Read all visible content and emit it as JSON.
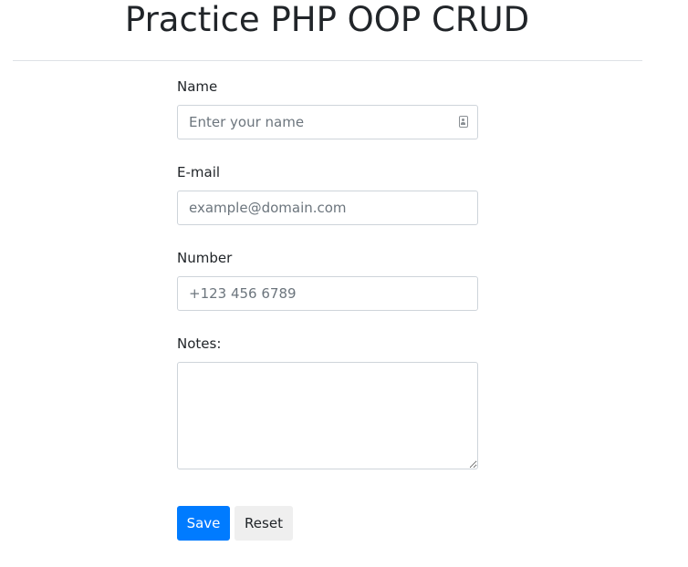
{
  "header": {
    "title": "Practice PHP OOP CRUD"
  },
  "form": {
    "name": {
      "label": "Name",
      "placeholder": "Enter your name",
      "icon": "contact-card-icon"
    },
    "email": {
      "label": "E-mail",
      "placeholder": "example@domain.com"
    },
    "number": {
      "label": "Number",
      "placeholder": "+123 456 6789"
    },
    "notes": {
      "label": "Notes:",
      "value": ""
    },
    "buttons": {
      "save_label": "Save",
      "reset_label": "Reset"
    }
  },
  "colors": {
    "primary": "#007bff",
    "secondary_button": "#efefef",
    "border": "#ced4da",
    "text": "#212529"
  }
}
